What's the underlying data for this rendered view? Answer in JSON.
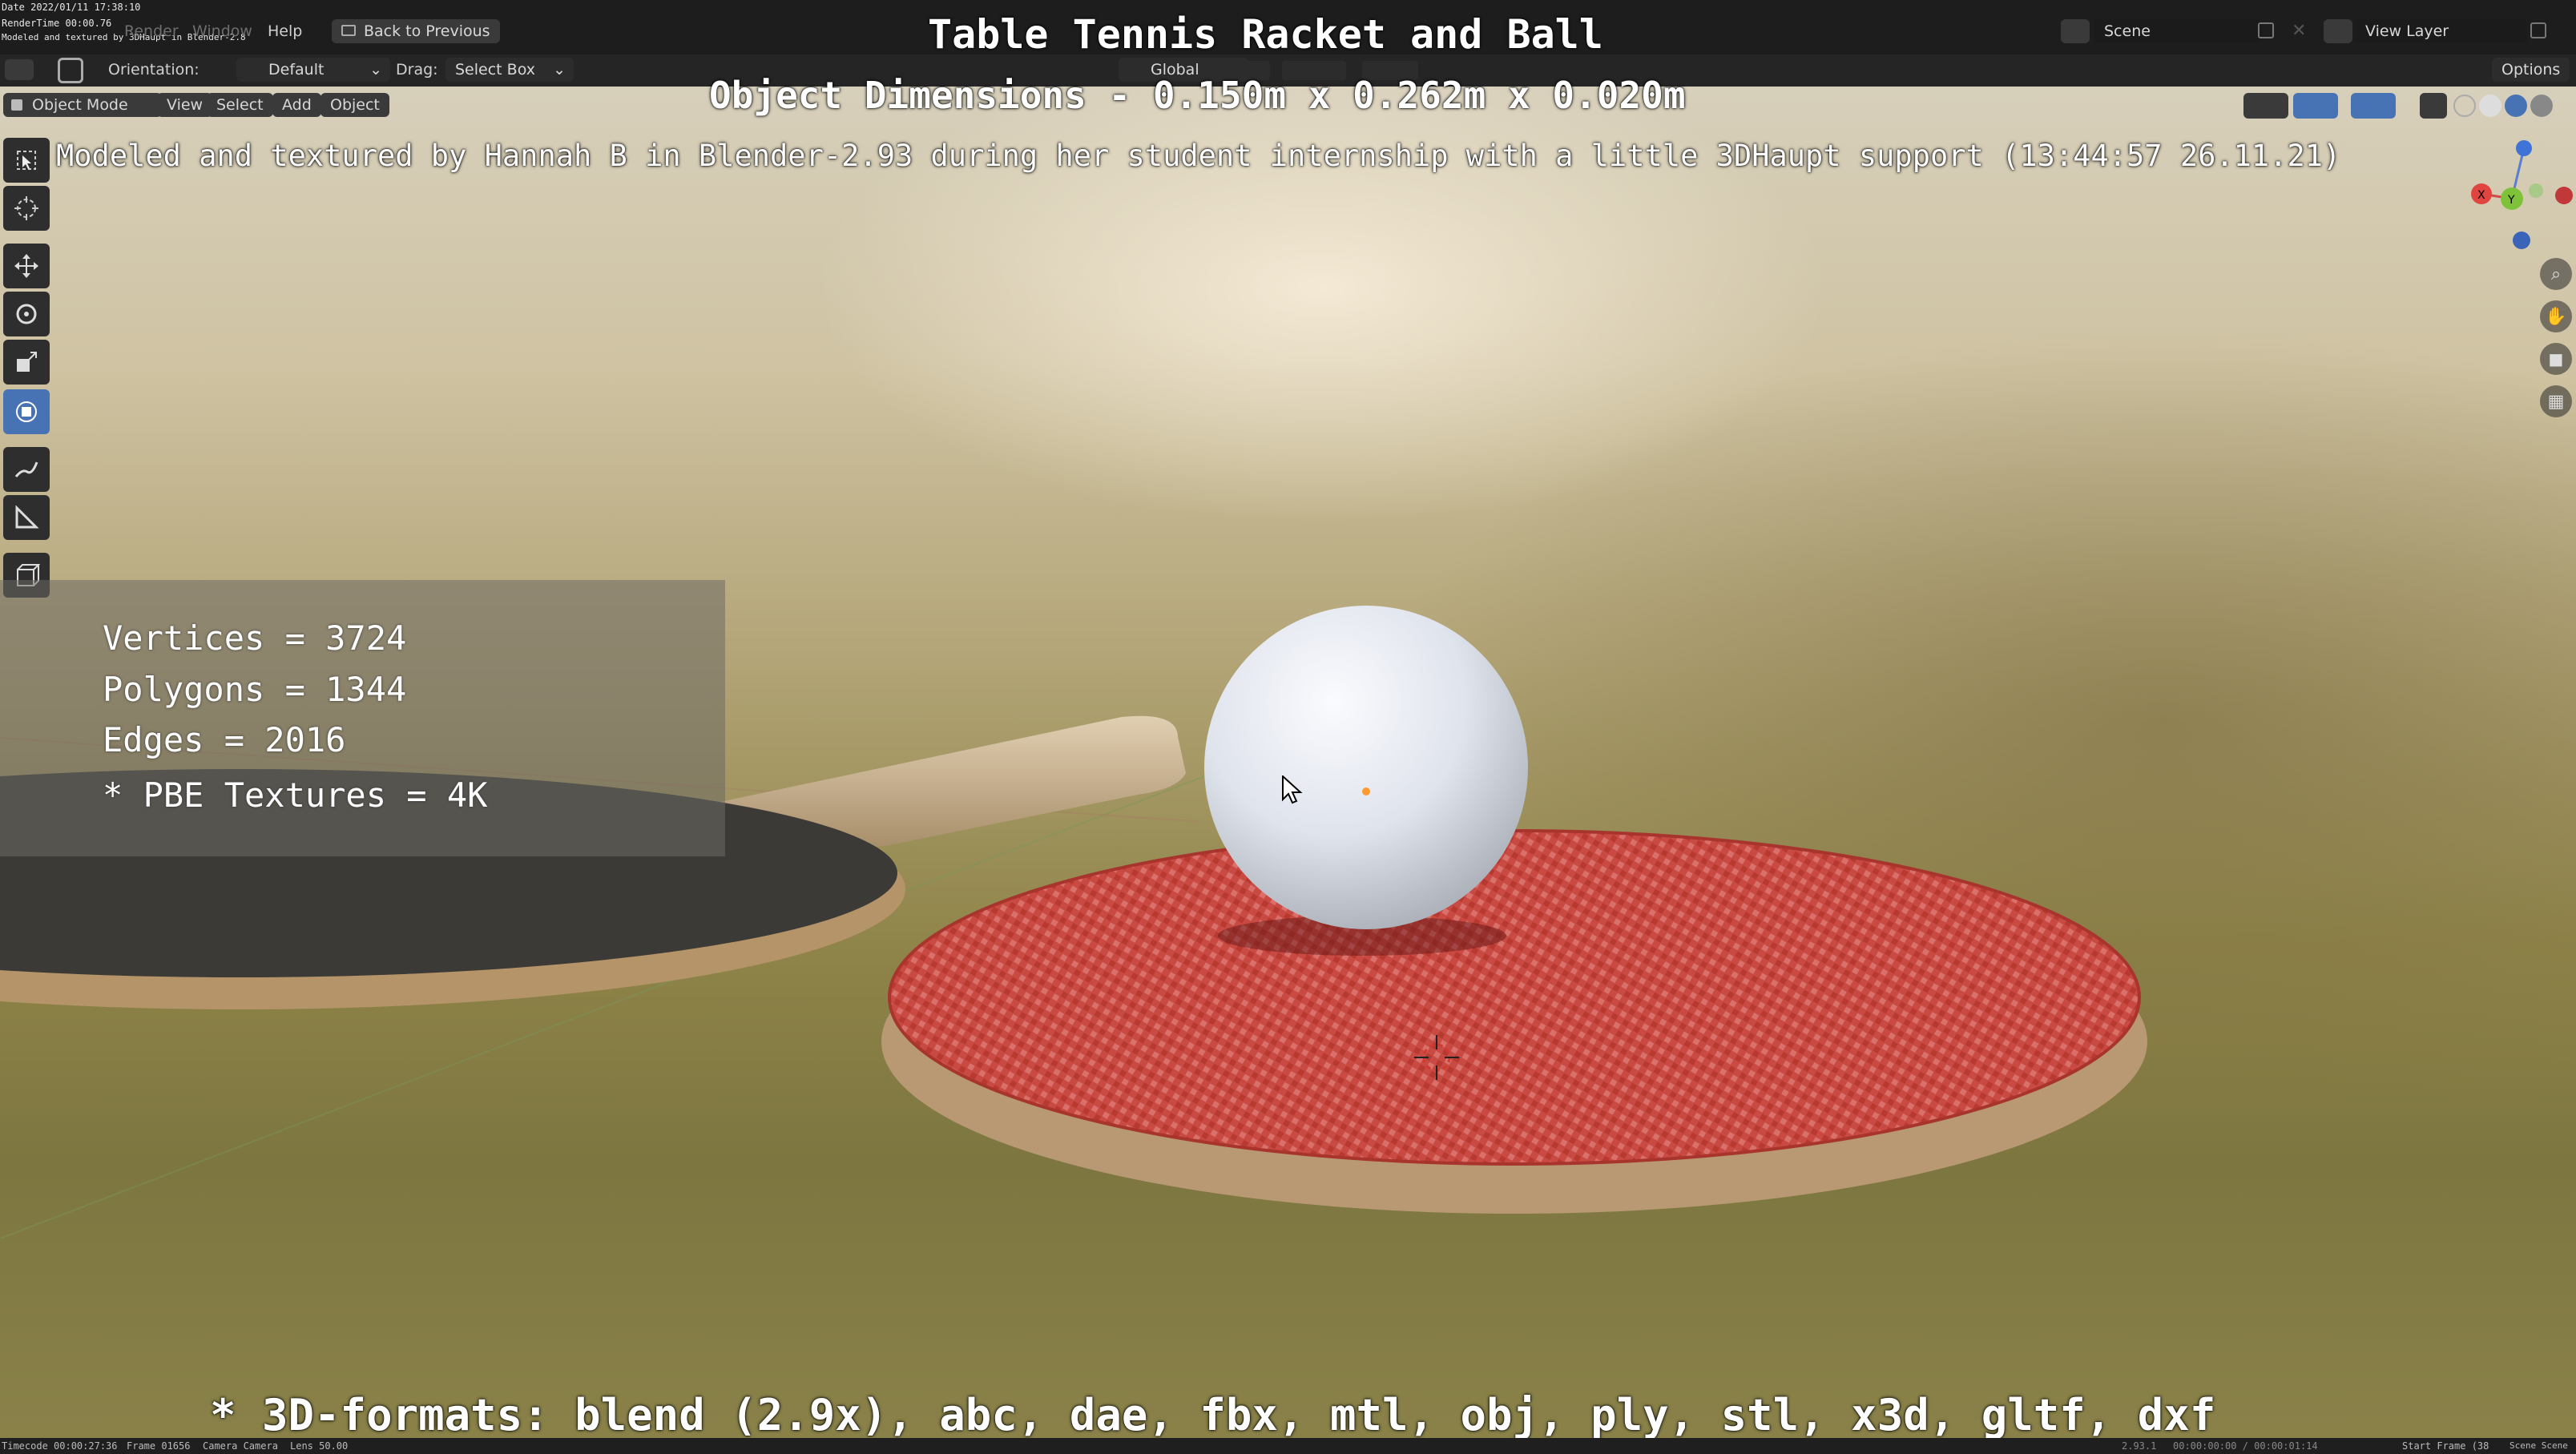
{
  "overlay": {
    "title": "Table Tennis Racket and Ball",
    "dimensions": "Object Dimensions -  0.150m x 0.262m x 0.020m",
    "credit": "Modeled and textured by Hannah B in Blender-2.93 during her student internship with a little 3DHaupt support (13:44:57 26.11.21)",
    "formats": "* 3D-formats: blend (2.9x), abc, dae, fbx, mtl, obj, ply, stl, x3d, gltf, dxf"
  },
  "render_info": {
    "date": "Date 2022/01/11 17:38:10",
    "render_time": "RenderTime 00:00.76",
    "note": "Modeled and textured by 3DHaupt in Blender-2.8"
  },
  "menu": {
    "items": [
      "Render",
      "Window",
      "Help"
    ],
    "back_button": "Back to Previous"
  },
  "scene": {
    "scene_label": "Scene",
    "view_layer_label": "View Layer"
  },
  "tool_header": {
    "orientation_label": "Orientation:",
    "orientation_value": "Default",
    "drag_label": "Drag:",
    "drag_value": "Select Box",
    "transform_space": "Global",
    "options_label": "Options"
  },
  "mode_header": {
    "mode": "Object Mode",
    "view": "View",
    "select": "Select",
    "add": "Add",
    "object": "Object"
  },
  "stats": {
    "vertices": "Vertices = 3724",
    "polygons": "Polygons = 1344",
    "edges": "Edges = 2016",
    "textures": "* PBE Textures = 4K"
  },
  "status_bar": {
    "timecode": "Timecode 00:00:27:36",
    "frame": "Frame 01656",
    "camera": "Camera Camera",
    "lens": "Lens 50.00",
    "version": "2.93.1",
    "time": "00:00:00:00 / 00:00:01:14",
    "start_frame": "Start Frame (38",
    "scene_right": "Scene Scene"
  },
  "colors": {
    "racket_red": "#c8453e",
    "active_tool": "#4772b3",
    "header_bg": "#1d1d1d"
  },
  "icons": [
    "select-box-icon",
    "cursor-icon",
    "move-icon",
    "rotate-icon",
    "scale-icon",
    "transform-icon",
    "annotate-icon",
    "measure-icon",
    "add-cube-icon",
    "zoom-icon",
    "hand-icon",
    "camera-icon",
    "grid-icon"
  ]
}
